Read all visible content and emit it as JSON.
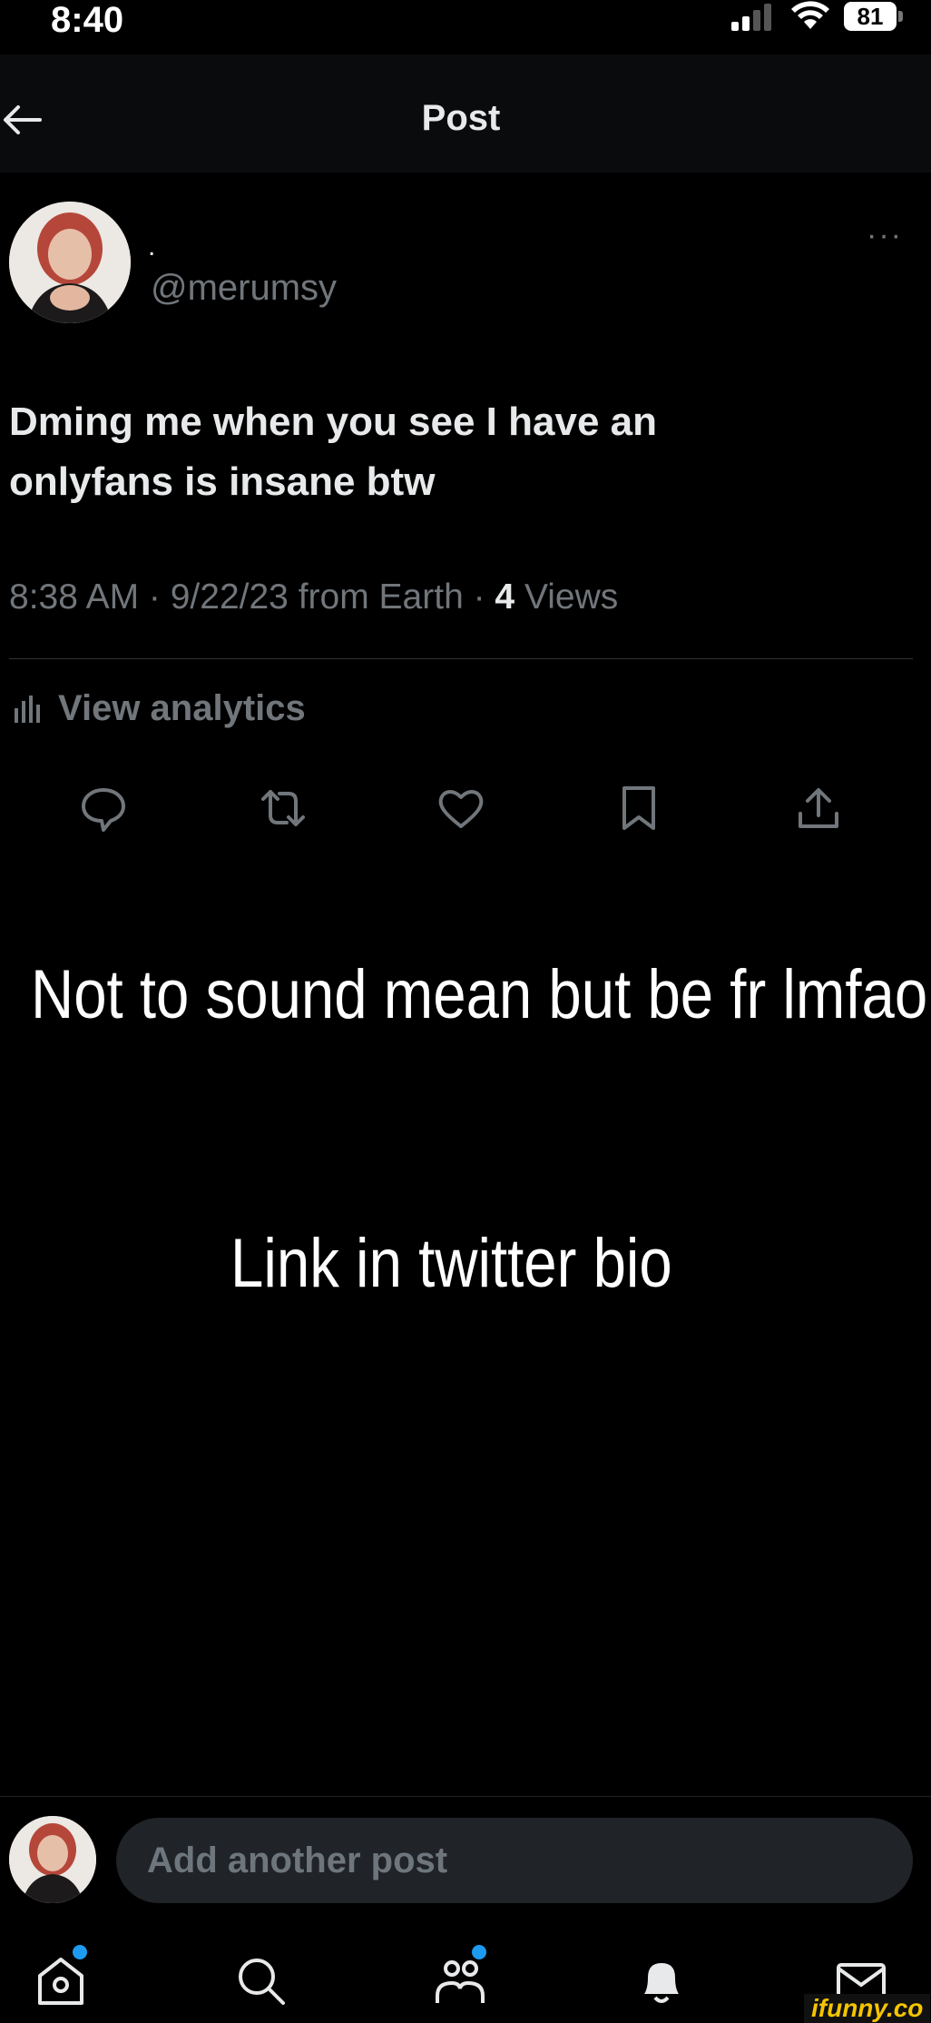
{
  "status_bar": {
    "time": "8:40",
    "battery": "81"
  },
  "header": {
    "title": "Post"
  },
  "post": {
    "display_name": ".",
    "handle": "@merumsy",
    "text_line1": "Dming me when you see I have an",
    "text_line2": "onlyfans is insane btw",
    "timestamp": "8:38 AM · 9/22/23 from Earth · ",
    "views_count": "4",
    "views_label": " Views",
    "more": "···"
  },
  "analytics": {
    "label": "View analytics"
  },
  "actions": {
    "icons": [
      "reply-icon",
      "repost-icon",
      "like-icon",
      "bookmark-icon",
      "share-icon"
    ]
  },
  "overlay": {
    "caption1": "Not to sound mean but be fr lmfao",
    "caption2": "Link in twitter bio"
  },
  "reply": {
    "placeholder": "Add another post"
  },
  "tab_bar": {
    "icons": [
      "home-icon",
      "search-icon",
      "communities-icon",
      "notifications-icon",
      "messages-icon"
    ],
    "accent": "#1d9bf0"
  },
  "watermark": "ifunny.co"
}
